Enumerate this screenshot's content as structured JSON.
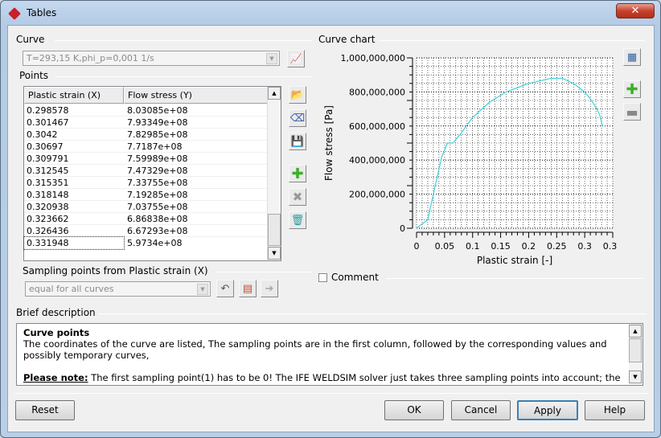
{
  "window": {
    "title": "Tables",
    "close_icon": "close-icon"
  },
  "curve": {
    "label": "Curve",
    "selected": "T=293,15 K,phi_p=0,001 1/s"
  },
  "points": {
    "label": "Points",
    "columns": [
      "Plastic strain (X)",
      "Flow stress (Y)"
    ],
    "rows": [
      [
        "0.298578",
        "8.03085e+08"
      ],
      [
        "0.301467",
        "7.93349e+08"
      ],
      [
        "0.3042",
        "7.82985e+08"
      ],
      [
        "0.30697",
        "7.7187e+08"
      ],
      [
        "0.309791",
        "7.59989e+08"
      ],
      [
        "0.312545",
        "7.47329e+08"
      ],
      [
        "0.315351",
        "7.33755e+08"
      ],
      [
        "0.318148",
        "7.19285e+08"
      ],
      [
        "0.320938",
        "7.03755e+08"
      ],
      [
        "0.323662",
        "6.86838e+08"
      ],
      [
        "0.326436",
        "6.67293e+08"
      ],
      [
        "0.331948",
        "5.9734e+08"
      ]
    ]
  },
  "sampling": {
    "label": "Sampling points from Plastic strain (X)",
    "selected": "equal for all curves"
  },
  "chart": {
    "label": "Curve chart",
    "comment_label": "Comment",
    "comment_checked": false
  },
  "chart_data": {
    "type": "line",
    "xlabel": "Plastic strain [-]",
    "ylabel": "Flow stress [Pa]",
    "xlim": [
      0,
      0.35
    ],
    "ylim": [
      0,
      1000000000
    ],
    "x_ticks": [
      "0",
      "0.05",
      "0.1",
      "0.15",
      "0.2",
      "0.25",
      "0.3",
      "0.35"
    ],
    "y_ticks": [
      "0",
      "200,000,000",
      "400,000,000",
      "600,000,000",
      "800,000,000",
      "1,000,000,000"
    ],
    "grid": true,
    "color": "#40d0d8",
    "x": [
      0,
      0.02,
      0.03,
      0.045,
      0.055,
      0.065,
      0.08,
      0.1,
      0.13,
      0.16,
      0.2,
      0.24,
      0.26,
      0.28,
      0.298578,
      0.3042,
      0.309791,
      0.315351,
      0.320938,
      0.326436,
      0.331948
    ],
    "y": [
      0,
      50000000,
      200000000,
      420000000,
      500000000,
      500000000,
      560000000,
      650000000,
      740000000,
      800000000,
      850000000,
      880000000,
      880000000,
      850000000,
      803085000,
      782985000,
      759989000,
      733755000,
      703755000,
      667293000,
      597340000
    ]
  },
  "description": {
    "label": "Brief description",
    "heading": "Curve points",
    "text": "The coordinates of the curve are listed, The sampling points are in the first column, followed by the corresponding values and possibly temporary curves,",
    "note_label": "Please note:",
    "note_text": " The first sampling point(1) has to be 0! The IFE WELDSIM solver just takes three sampling points into account; the"
  },
  "buttons": {
    "reset": "Reset",
    "ok": "OK",
    "cancel": "Cancel",
    "apply": "Apply",
    "help": "Help"
  }
}
